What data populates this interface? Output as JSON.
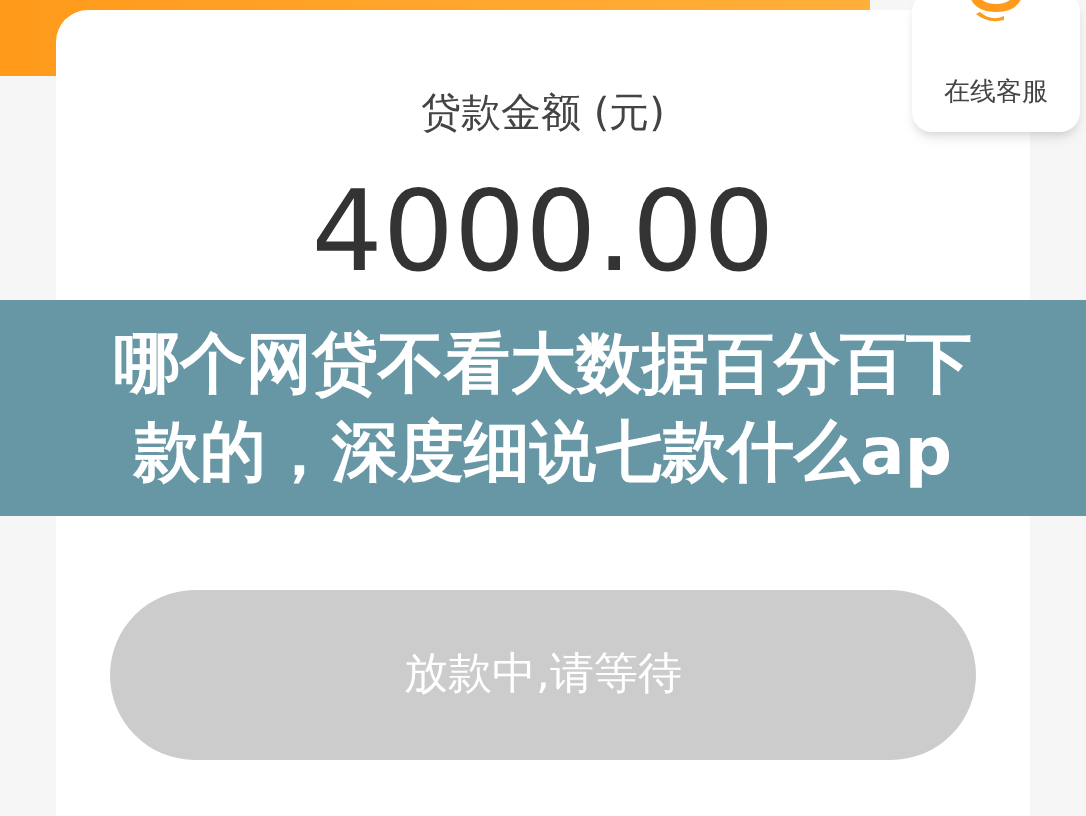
{
  "customer_service": {
    "label": "在线客服"
  },
  "loan": {
    "label": "贷款金额 (元)",
    "amount": "4000.00"
  },
  "banner": {
    "title": "哪个网贷不看大数据百分百下款的，深度细说七款什么ap"
  },
  "action_button": {
    "label": "放款中,请等待",
    "disabled": true
  }
}
